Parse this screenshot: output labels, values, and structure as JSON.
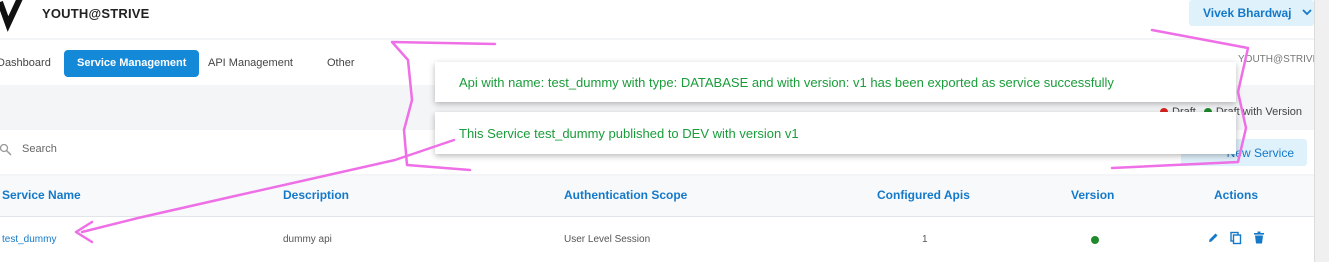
{
  "header": {
    "brand": "YOUTH@STRIVE",
    "user_name": "Vivek Bhardwaj",
    "user_chevron": "⌄"
  },
  "nav": {
    "items": [
      {
        "label": "Dashboard",
        "active": false
      },
      {
        "label": "Service Management",
        "active": true
      },
      {
        "label": "API Management",
        "active": false
      },
      {
        "label": "Other",
        "active": false
      }
    ],
    "right_org": "YOUTH@STRIVE"
  },
  "legend": {
    "draft_label": "Draft",
    "draft_with_version_label": "Draft with Version",
    "draft_color": "#d9241f",
    "version_color": "#1f8a2c"
  },
  "search": {
    "placeholder": "Search"
  },
  "new_service_button": "New Service",
  "table": {
    "columns": [
      "Service Name",
      "Description",
      "Authentication Scope",
      "Configured Apis",
      "Version",
      "Actions"
    ],
    "rows": [
      {
        "name": "test_dummy",
        "description": "dummy api",
        "auth_scope": "User Level Session",
        "configured_apis": "1",
        "version_status_color": "#1f8a2c",
        "actions": [
          "edit-icon",
          "copy-icon",
          "delete-icon"
        ]
      }
    ]
  },
  "toasts": [
    {
      "message": "Api with name: test_dummy with type: DATABASE and with version: v1 has been exported as service successfully"
    },
    {
      "message": "This Service test_dummy published to DEV with version v1"
    }
  ],
  "colors": {
    "accent": "#1489d8",
    "link": "#1479c9",
    "success_text": "#1a9c3a",
    "annotation": "#ee6fe6"
  }
}
